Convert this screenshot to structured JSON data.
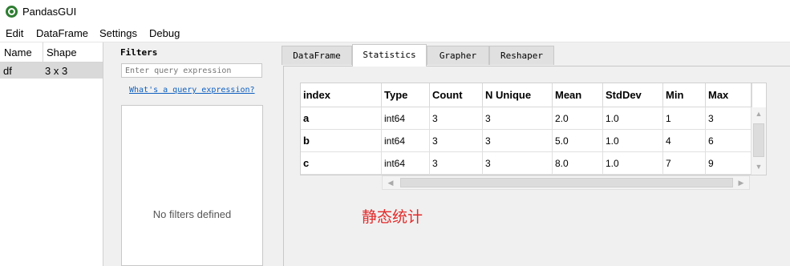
{
  "window": {
    "title": "PandasGUI"
  },
  "menu": [
    "Edit",
    "DataFrame",
    "Settings",
    "Debug"
  ],
  "dataframes": {
    "headers": [
      "Name",
      "Shape"
    ],
    "rows": [
      {
        "name": "df",
        "shape": "3 x 3"
      }
    ]
  },
  "filters": {
    "label": "Filters",
    "placeholder": "Enter query expression",
    "help_link": "What's a query expression?",
    "empty_text": "No filters defined"
  },
  "tabs": [
    "DataFrame",
    "Statistics",
    "Grapher",
    "Reshaper"
  ],
  "active_tab": "Statistics",
  "stats_table": {
    "columns": [
      "index",
      "Type",
      "Count",
      "N Unique",
      "Mean",
      "StdDev",
      "Min",
      "Max"
    ],
    "rows": [
      [
        "a",
        "int64",
        "3",
        "3",
        "2.0",
        "1.0",
        "1",
        "3"
      ],
      [
        "b",
        "int64",
        "3",
        "3",
        "5.0",
        "1.0",
        "4",
        "6"
      ],
      [
        "c",
        "int64",
        "3",
        "3",
        "8.0",
        "1.0",
        "7",
        "9"
      ]
    ]
  },
  "annotation": "静态统计",
  "colors": {
    "annotation": "#e32b2b",
    "link": "#1060c0",
    "selected_row": "#d9d9d9"
  }
}
